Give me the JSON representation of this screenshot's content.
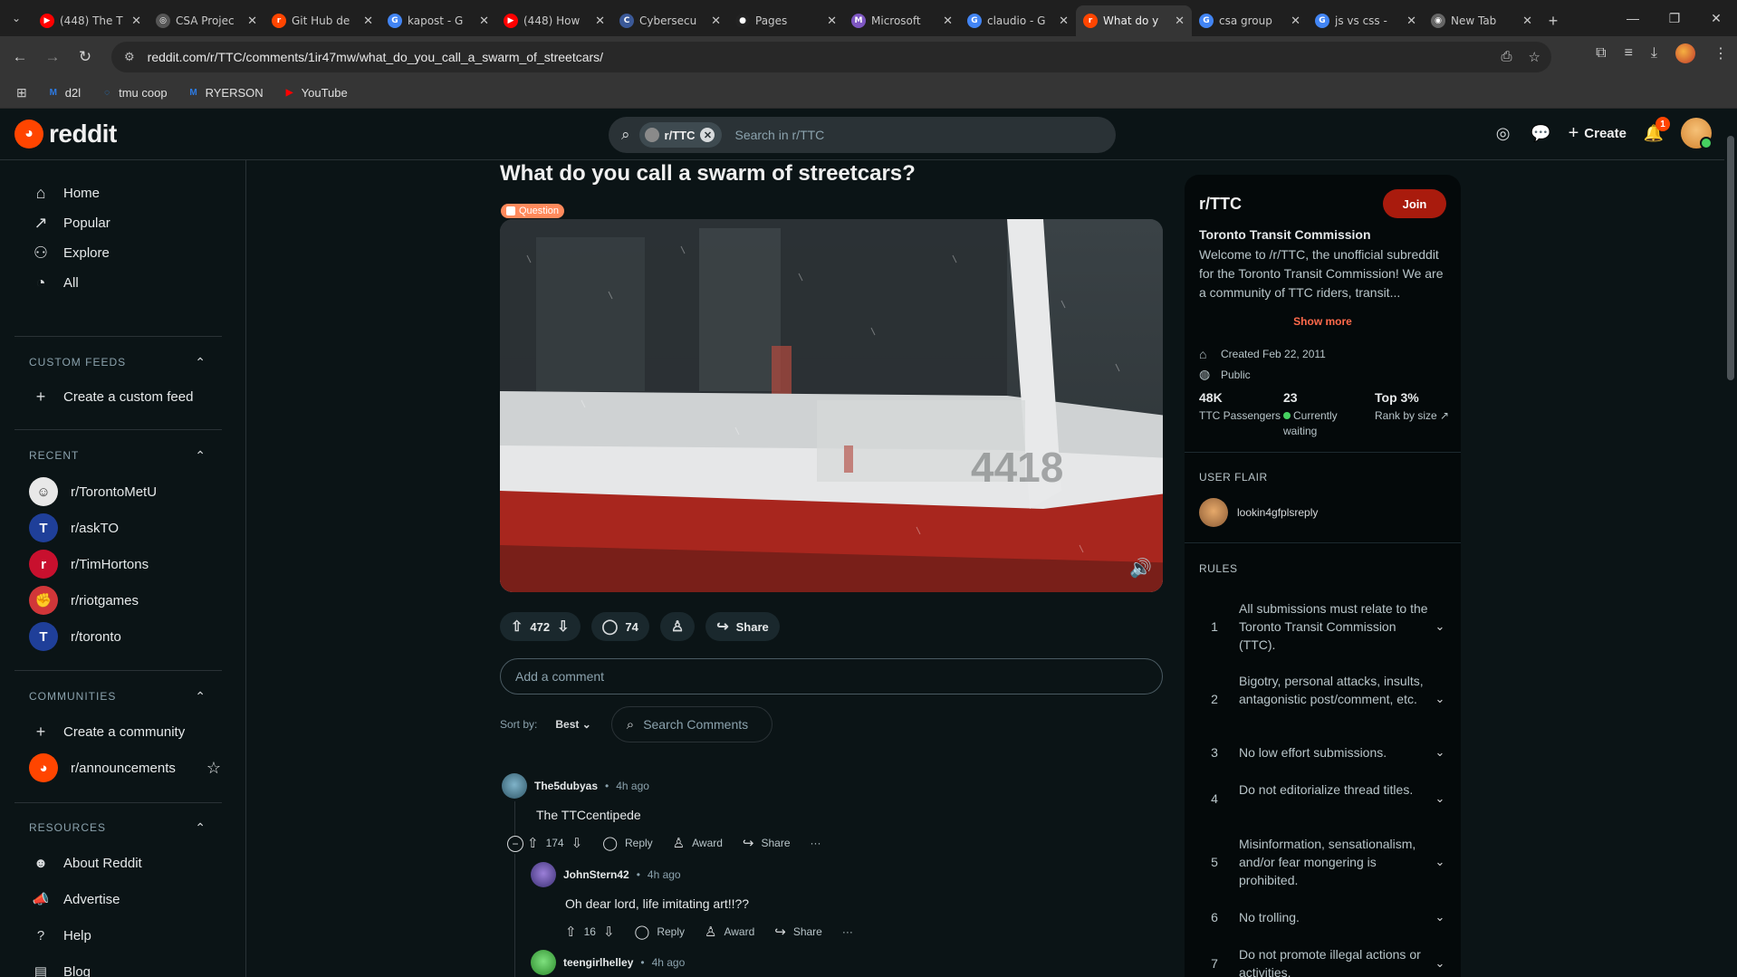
{
  "browser": {
    "tabs": [
      {
        "title": "(448) The T",
        "fav_color": "#ff0000",
        "fav_glyph": "▶"
      },
      {
        "title": "CSA Projec",
        "fav_color": "#555555",
        "fav_glyph": "◎"
      },
      {
        "title": "Git Hub de",
        "fav_color": "#ff4500",
        "fav_glyph": "r"
      },
      {
        "title": "kapost - G",
        "fav_color": "#4285f4",
        "fav_glyph": "G"
      },
      {
        "title": "(448) How",
        "fav_color": "#ff0000",
        "fav_glyph": "▶"
      },
      {
        "title": "Cybersecu",
        "fav_color": "#3b5998",
        "fav_glyph": "C"
      },
      {
        "title": "Pages",
        "fav_color": "#222222",
        "fav_glyph": "●"
      },
      {
        "title": "Microsoft",
        "fav_color": "#7e57c2",
        "fav_glyph": "M"
      },
      {
        "title": "claudio - G",
        "fav_color": "#4285f4",
        "fav_glyph": "G"
      },
      {
        "title": "What do y",
        "fav_color": "#ff4500",
        "fav_glyph": "r"
      },
      {
        "title": "csa group",
        "fav_color": "#4285f4",
        "fav_glyph": "G"
      },
      {
        "title": "js vs css -",
        "fav_color": "#4285f4",
        "fav_glyph": "G"
      },
      {
        "title": "New Tab",
        "fav_color": "#666666",
        "fav_glyph": "◉"
      }
    ],
    "active_tab_index": 9,
    "url": "reddit.com/r/TTC/comments/1ir47mw/what_do_you_call_a_swarm_of_streetcars/",
    "bookmarks": [
      {
        "label": "d2l",
        "icon_color": "#2d7be5",
        "glyph": "M"
      },
      {
        "label": "tmu coop",
        "icon_color": "#1e88e5",
        "glyph": "◌"
      },
      {
        "label": "RYERSON",
        "icon_color": "#2d7be5",
        "glyph": "M"
      },
      {
        "label": "YouTube",
        "icon_color": "#ff0000",
        "glyph": "▶"
      }
    ]
  },
  "header": {
    "logo_text": "reddit",
    "search_chip": "r/TTC",
    "search_placeholder": "Search in r/TTC",
    "create_label": "Create",
    "notif_count": "1"
  },
  "sidebar": {
    "main": [
      {
        "label": "Home",
        "icon": "home-icon",
        "glyph": "⌂"
      },
      {
        "label": "Popular",
        "icon": "popular-icon",
        "glyph": "↗"
      },
      {
        "label": "Explore",
        "icon": "explore-icon",
        "glyph": "⚇"
      },
      {
        "label": "All",
        "icon": "all-icon",
        "glyph": "◔"
      }
    ],
    "custom_feeds_heading": "CUSTOM FEEDS",
    "create_custom_feed": "Create a custom feed",
    "recent_heading": "RECENT",
    "recent": [
      {
        "label": "r/TorontoMetU",
        "color": "#e8e8e8",
        "glyph": "☺"
      },
      {
        "label": "r/askTO",
        "color": "#1f3f99",
        "glyph": "T"
      },
      {
        "label": "r/TimHortons",
        "color": "#c8102e",
        "glyph": "r"
      },
      {
        "label": "r/riotgames",
        "color": "#d13639",
        "glyph": "✊"
      },
      {
        "label": "r/toronto",
        "color": "#1f3f99",
        "glyph": "T"
      }
    ],
    "communities_heading": "COMMUNITIES",
    "create_community": "Create a community",
    "announcements": "r/announcements",
    "resources_heading": "RESOURCES",
    "resources": [
      {
        "label": "About Reddit",
        "icon": "about-icon",
        "glyph": "☻"
      },
      {
        "label": "Advertise",
        "icon": "advertise-icon",
        "glyph": "📣"
      },
      {
        "label": "Help",
        "icon": "help-icon",
        "glyph": "?"
      },
      {
        "label": "Blog",
        "icon": "blog-icon",
        "glyph": "▤"
      }
    ]
  },
  "post": {
    "title": "What do you call a swarm of streetcars?",
    "flair": "Question",
    "votes": "472",
    "comments": "74",
    "share": "Share",
    "add_comment_placeholder": "Add a comment",
    "sort_label": "Sort by:",
    "sort_value": "Best",
    "search_comments": "Search Comments",
    "video_fleet_number": "4418"
  },
  "comments": [
    {
      "user": "The5dubyas",
      "time": "4h ago",
      "body": "The TTCcentipede",
      "votes": "174",
      "reply": "Reply",
      "award": "Award",
      "share": "Share"
    },
    {
      "user": "JohnStern42",
      "time": "4h ago",
      "body": "Oh dear lord, life imitating art!!??",
      "votes": "16",
      "reply": "Reply",
      "award": "Award",
      "share": "Share"
    },
    {
      "user": "teengirlhelley",
      "time": "4h ago"
    }
  ],
  "community": {
    "name": "r/TTC",
    "join": "Join",
    "full_name": "Toronto Transit Commission",
    "description": "Welcome to /r/TTC, the unofficial subreddit for the Toronto Transit Commission! We are a community of TTC riders, transit...",
    "show_more": "Show more",
    "created": "Created Feb 22, 2011",
    "visibility": "Public",
    "members": "48K",
    "members_label": "TTC Passengers",
    "online": "23",
    "online_label_1": "Currently",
    "online_label_2": "waiting",
    "rank": "Top 3%",
    "rank_label": "Rank by size",
    "user_flair_heading": "USER FLAIR",
    "user_flair_name": "lookin4gfplsreply",
    "rules_heading": "RULES",
    "rules": [
      "All submissions must relate to the Toronto Transit Commission (TTC).",
      "Bigotry, personal attacks, insults, antagonistic post/comment, etc.",
      "No low effort submissions.",
      "Do not editorialize thread titles.",
      "Misinformation, sensationalism, and/or fear mongering is prohibited.",
      "No trolling.",
      "Do not promote illegal actions or activities."
    ]
  }
}
